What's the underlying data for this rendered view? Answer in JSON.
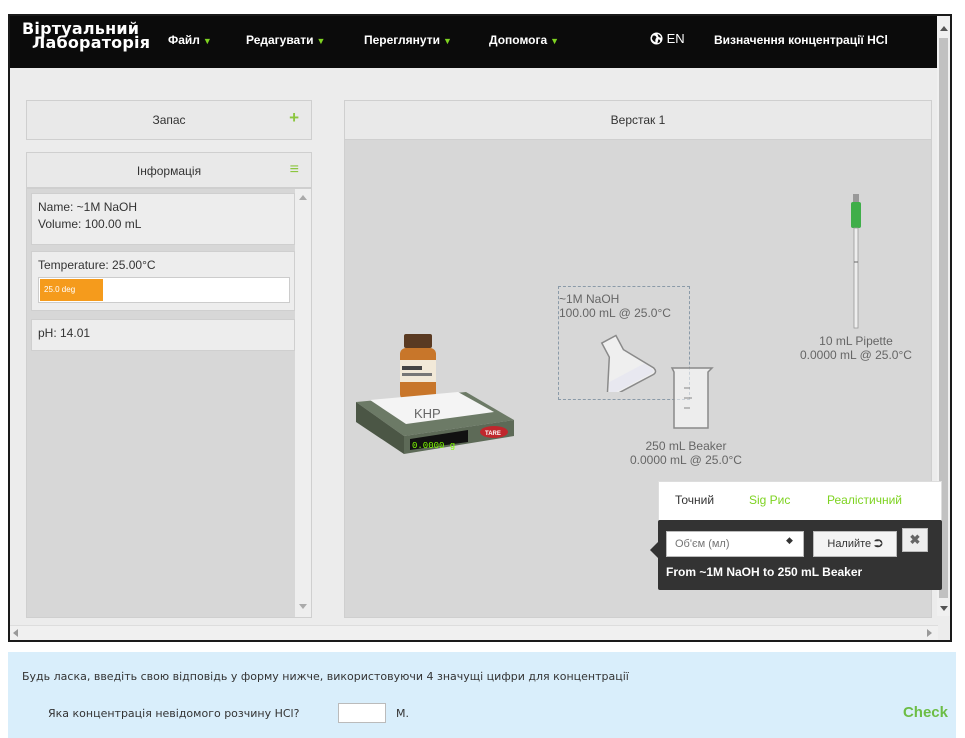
{
  "navbar": {
    "brand_line1": "Віртуальний",
    "brand_line2": "Лабораторія",
    "menu": [
      "Файл",
      "Редагувати",
      "Переглянути",
      "Допомога"
    ],
    "lang": "EN",
    "title": "Визначення концентрації HCl"
  },
  "stockroom": {
    "label": "Запас"
  },
  "info": {
    "label": "Інформація",
    "name": "Name: ~1M NaOH",
    "volume": "Volume: 100.00 mL",
    "temperature": "Temperature: 25.00°C",
    "temp_bar_label": "25.0 deg",
    "temp_fraction": 0.25,
    "ph": "pH: 14.01"
  },
  "workbench": {
    "label": "Верстак 1",
    "balance": {
      "reading": "0.0000 g",
      "tare": "TARE",
      "item_label": "KHP"
    },
    "flask": {
      "name": "~1M NaOH",
      "detail": "100.00 mL @ 25.0°C"
    },
    "beaker": {
      "name": "250 mL Beaker",
      "detail": "0.0000 mL @ 25.0°C"
    },
    "pipette": {
      "name": "10 mL Pipette",
      "detail": "0.0000 mL @ 25.0°C"
    }
  },
  "pour": {
    "tabs": [
      "Точний",
      "Sig Рис",
      "Реалістичний"
    ],
    "placeholder": "Об'єм (мл)",
    "button": "Налийте",
    "close": "✖",
    "description": "From ~1M NaOH to 250 mL Beaker"
  },
  "answer": {
    "instruction": "Будь ласка, введіть свою відповідь у форму нижче, використовуючи 4 значущі цифри для концентрації",
    "question": "Яка концентрація невідомого розчину HCl?",
    "unit": "M.",
    "check": "Check"
  },
  "colors": {
    "accent": "#8cc63f",
    "temp_fill": "#f59b1c",
    "navbar": "#0b0b0b"
  }
}
